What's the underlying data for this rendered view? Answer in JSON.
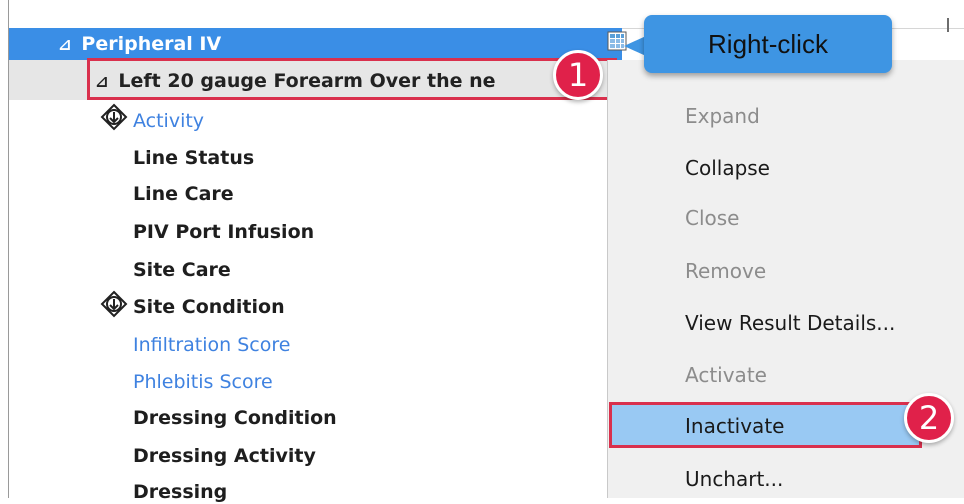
{
  "tree": {
    "group_label": "Peripheral IV",
    "group_collapse_glyph": "⊿",
    "node_label": "Left 20 gauge Forearm Over the ne",
    "node_collapse_glyph": "⊿",
    "items": [
      {
        "label": "Activity",
        "style": "link",
        "has_pin": true
      },
      {
        "label": "Line Status",
        "style": "bold",
        "has_pin": false
      },
      {
        "label": "Line Care",
        "style": "bold",
        "has_pin": false
      },
      {
        "label": "PIV Port Infusion",
        "style": "bold",
        "has_pin": false
      },
      {
        "label": "Site Care",
        "style": "bold",
        "has_pin": false
      },
      {
        "label": "Site Condition",
        "style": "bold",
        "has_pin": true
      },
      {
        "label": "Infiltration Score",
        "style": "link",
        "has_pin": false
      },
      {
        "label": "Phlebitis Score",
        "style": "link",
        "has_pin": false
      },
      {
        "label": "Dressing Condition",
        "style": "bold",
        "has_pin": false
      },
      {
        "label": "Dressing Activity",
        "style": "bold",
        "has_pin": false
      },
      {
        "label": "Dressing",
        "style": "bold",
        "has_pin": false
      }
    ]
  },
  "context_menu": {
    "items": [
      {
        "label": "Expand",
        "enabled": false
      },
      {
        "label": "Collapse",
        "enabled": true
      },
      {
        "label": "Close",
        "enabled": false
      },
      {
        "label": "Remove",
        "enabled": false
      },
      {
        "label": "View Result Details...",
        "enabled": true
      },
      {
        "label": "Activate",
        "enabled": false
      },
      {
        "label": "Inactivate",
        "enabled": true,
        "selected": true
      },
      {
        "label": "Unchart...",
        "enabled": true
      }
    ]
  },
  "annotations": {
    "step1": "1",
    "step2": "2",
    "callout_text": "Right-click"
  },
  "colors": {
    "header_blue": "#3a8ee6",
    "link_blue": "#3f82e0",
    "highlight_red": "#d9304d",
    "badge_red": "#e0214a",
    "selected_item_bg": "#99c9f3",
    "callout_blue": "#3e95e3"
  }
}
